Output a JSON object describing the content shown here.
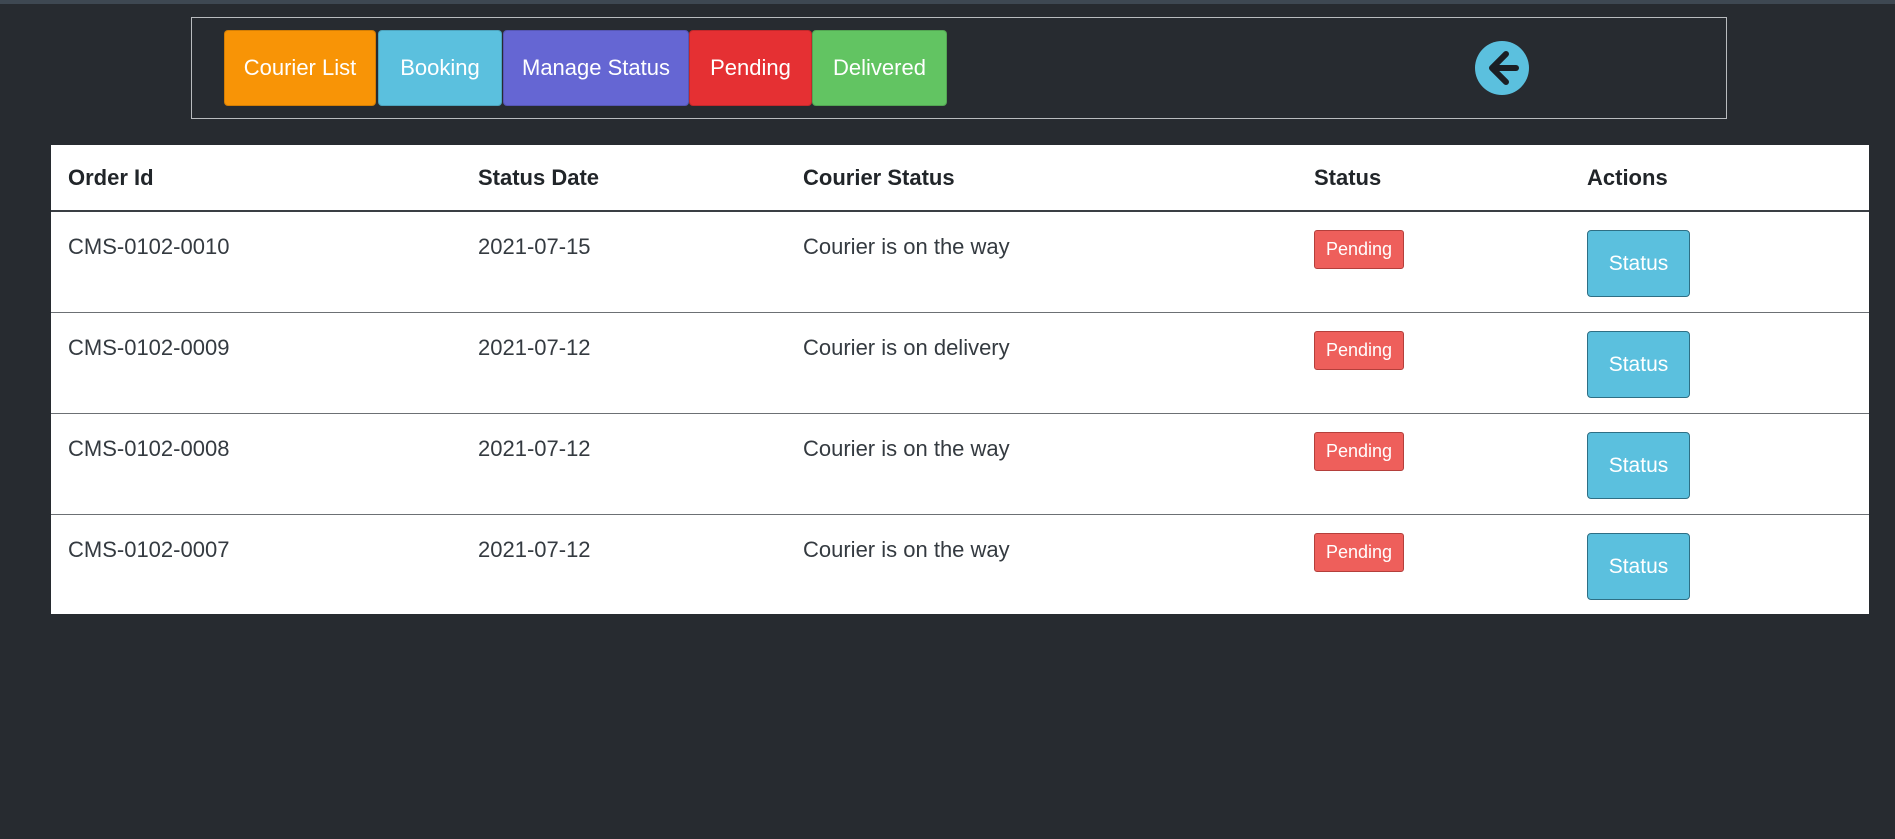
{
  "nav": {
    "buttons": [
      {
        "label": "Courier List",
        "color": "#f89406"
      },
      {
        "label": "Booking",
        "color": "#5bc0de"
      },
      {
        "label": "Manage Status",
        "color": "#6566d3"
      },
      {
        "label": "Pending",
        "color": "#e53033"
      },
      {
        "label": "Delivered",
        "color": "#62c462"
      }
    ],
    "back_icon": "arrow-left-circle-icon",
    "back_color": "#5bc0de"
  },
  "table": {
    "headers": [
      "Order Id",
      "Status Date",
      "Courier Status",
      "Status",
      "Actions"
    ],
    "rows": [
      {
        "order_id": "CMS-0102-0010",
        "date": "2021-07-15",
        "courier_status": "Courier is on the way",
        "status": "Pending",
        "action": "Status"
      },
      {
        "order_id": "CMS-0102-0009",
        "date": "2021-07-12",
        "courier_status": "Courier is on delivery",
        "status": "Pending",
        "action": "Status"
      },
      {
        "order_id": "CMS-0102-0008",
        "date": "2021-07-12",
        "courier_status": "Courier is on the way",
        "status": "Pending",
        "action": "Status"
      },
      {
        "order_id": "CMS-0102-0007",
        "date": "2021-07-12",
        "courier_status": "Courier is on the way",
        "status": "Pending",
        "action": "Status"
      }
    ]
  },
  "colors": {
    "background": "#272b30",
    "badge_pending": "#ee5f5b",
    "action_button": "#5bc0de"
  }
}
